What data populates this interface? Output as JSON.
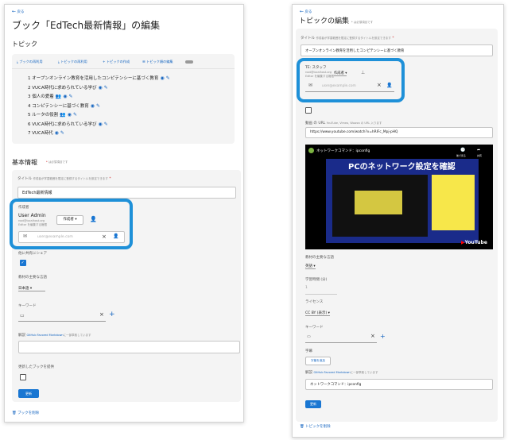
{
  "left": {
    "back": "戻る",
    "title": "ブック「EdTech最新情報」の編集",
    "topics_heading": "トピック",
    "toolbar": [
      "ブックの再利用",
      "トピックの再利用",
      "トピックの作成",
      "トピック順の編集"
    ],
    "topics": [
      {
        "n": "1",
        "title": "オープンオンライン教育を活用したコンピテンシーに基づく教育"
      },
      {
        "n": "2",
        "title": "VUCA時代に求められている学び"
      },
      {
        "n": "3",
        "title": "個人の愛着"
      },
      {
        "n": "4",
        "title": "コンピテンシーに基づく教育"
      },
      {
        "n": "5",
        "title": "ルータの役割"
      },
      {
        "n": "6",
        "title": "VUCA時代に求められている学び"
      },
      {
        "n": "7",
        "title": "VUCA時代"
      }
    ],
    "basic_heading": "基本情報",
    "required_note": "は必須項目です",
    "title_label": "タイトル",
    "title_hint": "作成者が学習範囲を限定に登録するタイトルを設定できます",
    "title_value": "EdTech最新情報",
    "author_label": "作成者",
    "author_name": "User Admin",
    "author_email": "root@localhost.org",
    "author_note": "Editor を編集する権限",
    "author_role": "作成者",
    "email_placeholder": "user@example.com",
    "shared_label": "他に共有にシェア",
    "language_label": "教材の主要な言語",
    "language_value": "日本語",
    "keyword_label": "キーワード",
    "desc_label": "解説",
    "desc_hint_link": "GitHub Favored Markdown",
    "desc_hint_rest": "に一部準拠しています",
    "provide_label": "更新したブックを提供",
    "submit": "更新",
    "delete": "ブックを削除"
  },
  "right": {
    "back": "戻る",
    "title": "トピックの編集",
    "title_note": "* は必須項目です",
    "title_label": "タイトル",
    "title_hint": "作成者が学習範囲を限定に登録するタイトルを設定できます",
    "title_value": "オープンオンライン教育を活用したコンピテンシーに基づく教育",
    "author_label": "TE: スタッフ",
    "author_email": "root@localhost.org",
    "author_note": "Editor を編集する権限",
    "author_role": "作成者",
    "email_placeholder": "user@example.com",
    "video_label": "動画 の URL",
    "video_hint": "YouTube, Vimeo, Wowza の URL 入ります",
    "video_value": "https://www.youtube.com/watch?v=hRIFc_Mpj-pHQ",
    "video_channel": "ネットワークコマンド：ipconfig",
    "video_overlay_title": "PCのネットワーク設定を確認",
    "video_share": "共有",
    "video_later": "後で見る",
    "video_brand": "YouTube",
    "language_label": "教材の主要な言語",
    "language_value": "英語",
    "time_label": "学習時間 (分)",
    "time_value": "1",
    "license_label": "ライセンス",
    "license_value": "CC BY (表示)",
    "keyword_label": "キーワード",
    "subtitle_label": "字幕",
    "subtitle_button": "字幕を追加",
    "desc_label": "解説",
    "desc_hint_link": "GitHub Favored Markdown",
    "desc_hint_rest": "に一部準拠しています",
    "desc_value": "ネットワークコマンド：ipconfig",
    "submit": "更新",
    "delete": "トピックを削除"
  },
  "colors": {
    "accent": "#1976d2",
    "highlight": "#1e90d8",
    "required": "#d32f2f",
    "orange": "#f57c00"
  }
}
